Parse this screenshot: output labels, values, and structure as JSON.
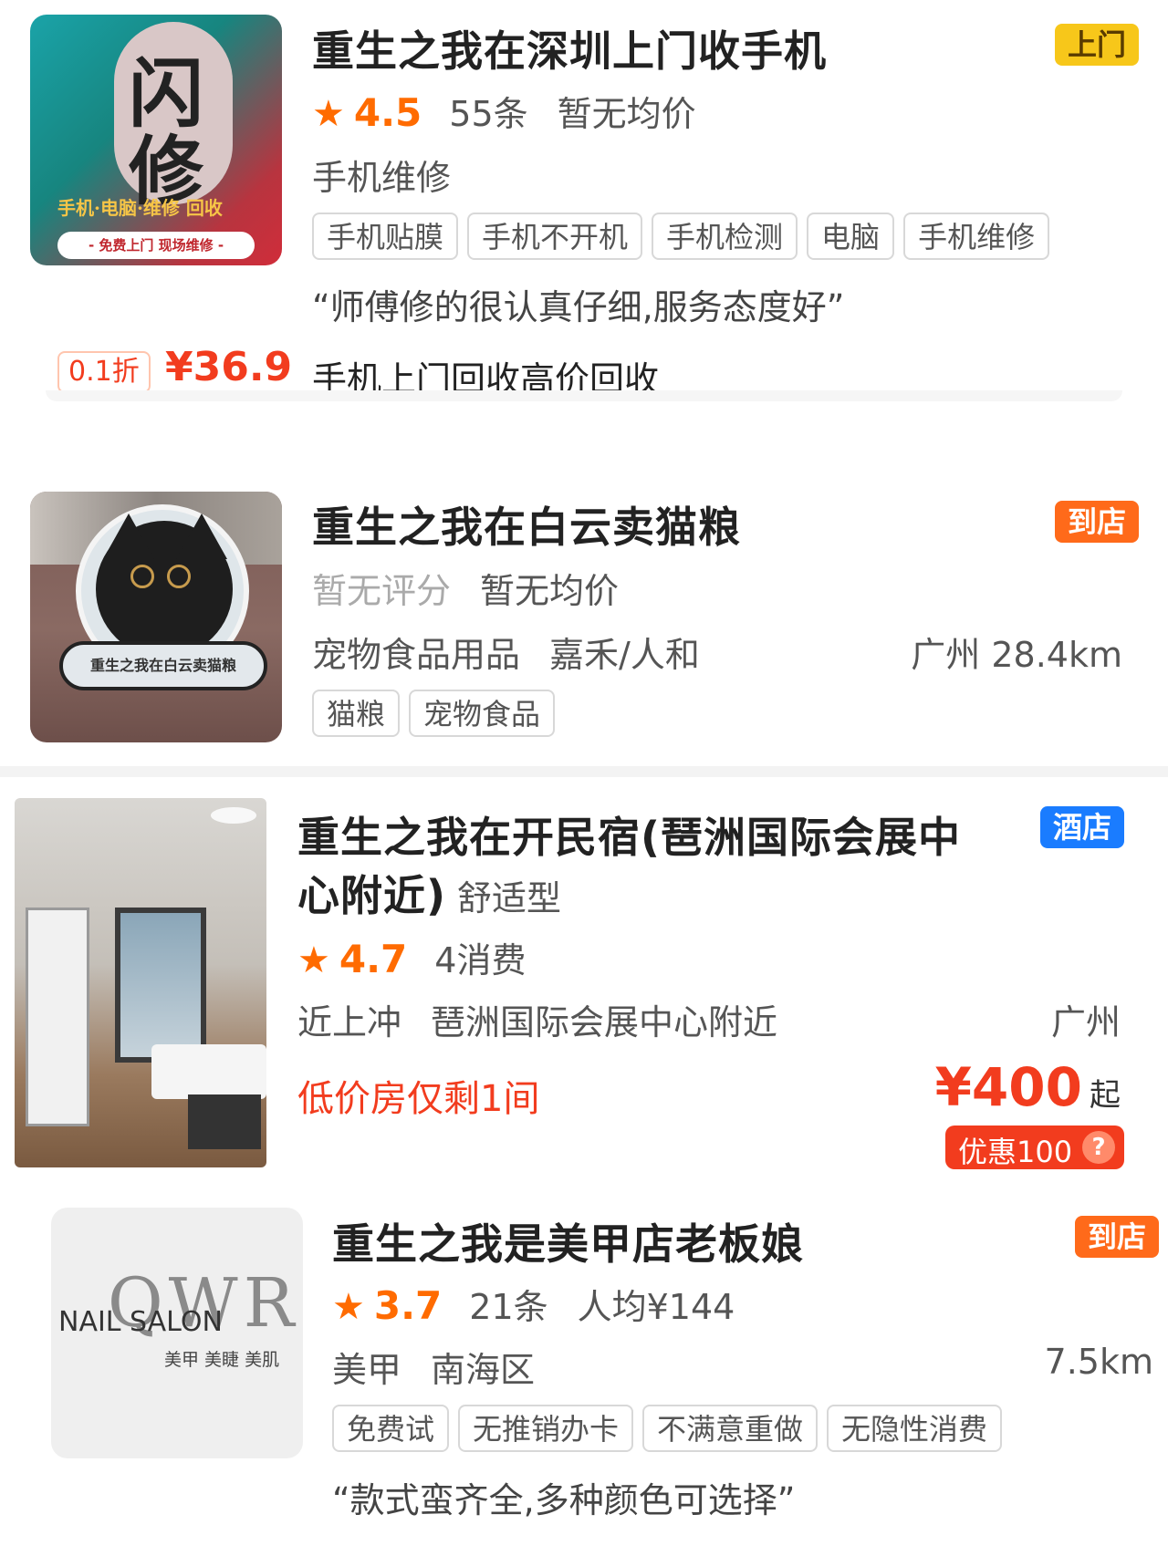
{
  "listings": [
    {
      "thumb_text": {
        "big1": "闪",
        "big2": "修",
        "line1": "手机·电脑·维修 回收",
        "line2": "- 免费上门  现场维修 -"
      },
      "title": "重生之我在深圳上门收手机",
      "badge": "上门",
      "badge_color": "#f7c71a",
      "rating": "4.5",
      "reviews": "55条",
      "avg_price": "暂无均价",
      "category": "手机维修",
      "tags": [
        "手机贴膜",
        "手机不开机",
        "手机检测",
        "电脑",
        "手机维修"
      ],
      "quote": "“师傅修的很认真仔细,服务态度好”",
      "deal_discount": "0.1折",
      "deal_price": "¥36.9",
      "deal_desc": "手机上门回收高价回收"
    },
    {
      "thumb_text": "重生之我在白云卖猫粮",
      "title": "重生之我在白云卖猫粮",
      "badge": "到店",
      "badge_color": "#ff6a1a",
      "rating_text": "暂无评分",
      "avg_price": "暂无均价",
      "category": "宠物食品用品",
      "area": "嘉禾/人和",
      "distance": "广州 28.4km",
      "tags": [
        "猫粮",
        "宠物食品"
      ]
    },
    {
      "title_line1": "重生之我在开民宿(琶洲国际会展中",
      "title_line2": "心附近)",
      "title_suffix": "舒适型",
      "badge": "酒店",
      "badge_color": "#1a7cff",
      "rating": "4.7",
      "consumes": "4消费",
      "area1": "近上冲",
      "area2": "琶洲国际会展中心附近",
      "city": "广州",
      "promo": "低价房仅剩1间",
      "price": "¥400",
      "price_suffix": "起",
      "discount_tag": "优惠100",
      "help_icon": "?"
    },
    {
      "thumb_text": {
        "brand": "QWR",
        "nail": "NAIL SALON",
        "sub": "美甲 美睫 美肌"
      },
      "title": "重生之我是美甲店老板娘",
      "badge": "到店",
      "badge_color": "#ff6a1a",
      "rating": "3.7",
      "reviews": "21条",
      "avg_price": "人均¥144",
      "category": "美甲",
      "area": "南海区",
      "distance": "7.5km",
      "tags": [
        "免费试",
        "无推销办卡",
        "不满意重做",
        "无隐性消费"
      ],
      "quote": "“款式蛮齐全,多种颜色可选择”"
    }
  ],
  "colors": {
    "accent": "#ff6b00",
    "price_red": "#f23c1e"
  }
}
